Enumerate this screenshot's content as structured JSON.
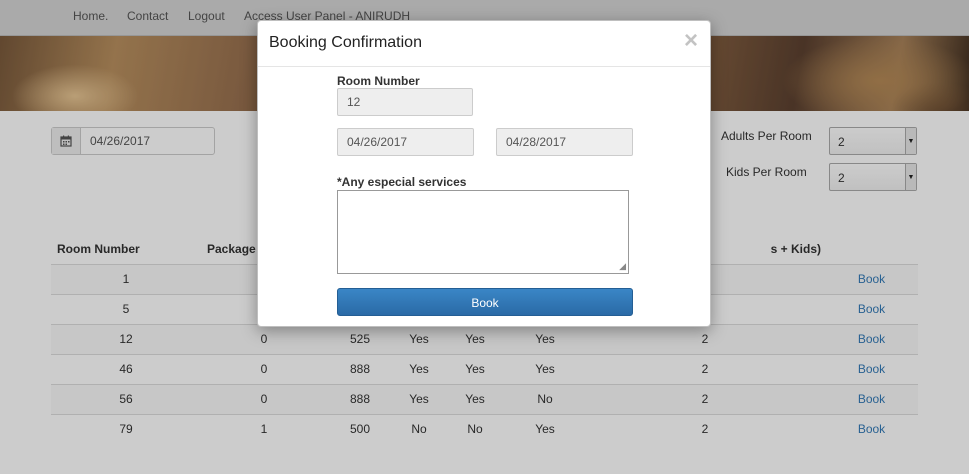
{
  "nav": {
    "home": "Home.",
    "contact": "Contact",
    "logout": "Logout",
    "user_panel": "Access User Panel - ANIRUDH"
  },
  "search": {
    "date": "04/26/2017",
    "adults_label": "Adults Per Room",
    "adults_value": "2",
    "kids_label": "Kids Per Room",
    "kids_value": "2"
  },
  "table": {
    "headers": {
      "room": "Room Number",
      "package": "Package",
      "guests": "s + Kids)"
    },
    "rows": [
      {
        "room": "1",
        "package": "",
        "price": "",
        "a": "",
        "b": "",
        "c": "",
        "guests": "",
        "book": "Book"
      },
      {
        "room": "5",
        "package": "",
        "price": "",
        "a": "",
        "b": "",
        "c": "",
        "guests": "",
        "book": "Book"
      },
      {
        "room": "12",
        "package": "0",
        "price": "525",
        "a": "Yes",
        "b": "Yes",
        "c": "Yes",
        "guests": "2",
        "book": "Book"
      },
      {
        "room": "46",
        "package": "0",
        "price": "888",
        "a": "Yes",
        "b": "Yes",
        "c": "Yes",
        "guests": "2",
        "book": "Book"
      },
      {
        "room": "56",
        "package": "0",
        "price": "888",
        "a": "Yes",
        "b": "Yes",
        "c": "No",
        "guests": "2",
        "book": "Book"
      },
      {
        "room": "79",
        "package": "1",
        "price": "500",
        "a": "No",
        "b": "No",
        "c": "Yes",
        "guests": "2",
        "book": "Book"
      }
    ]
  },
  "modal": {
    "title": "Booking Confirmation",
    "close": "×",
    "room_label": "Room Number",
    "room_value": "12",
    "from_date": "04/26/2017",
    "to_date": "04/28/2017",
    "services_label": "*Any especial services",
    "services_value": "",
    "book_label": "Book"
  },
  "icons": {
    "calendar": "calendar-icon",
    "caret": "caret-down-icon",
    "close": "close-icon",
    "resize": "resize-handle-icon"
  },
  "colors": {
    "link": "#337ab7",
    "primary_button": "#2f72b0"
  }
}
